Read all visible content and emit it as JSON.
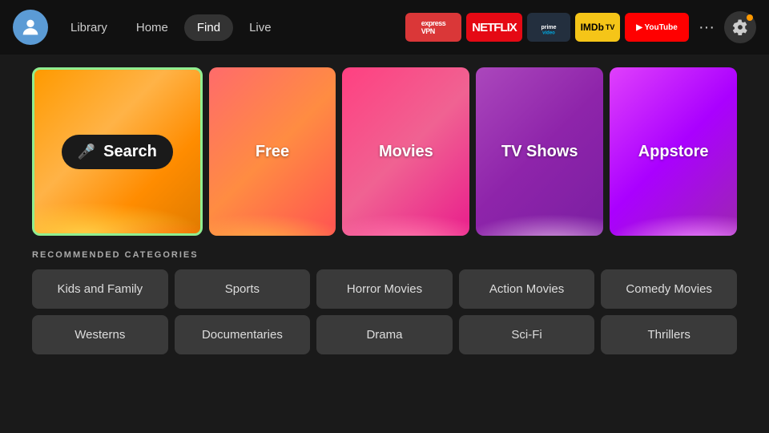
{
  "nav": {
    "links": [
      {
        "label": "Library",
        "active": false
      },
      {
        "label": "Home",
        "active": false
      },
      {
        "label": "Find",
        "active": true
      },
      {
        "label": "Live",
        "active": false
      }
    ],
    "apps": [
      {
        "id": "expressvpn",
        "label": "ExpressVPN"
      },
      {
        "id": "netflix",
        "label": "NETFLIX"
      },
      {
        "id": "prime",
        "label": "prime video"
      },
      {
        "id": "imdb",
        "label": "IMDb TV"
      },
      {
        "id": "youtube",
        "label": "▶ YouTube"
      },
      {
        "id": "more",
        "label": "···"
      }
    ],
    "settings_label": "⚙"
  },
  "tiles": [
    {
      "id": "search",
      "label": "Search",
      "type": "search"
    },
    {
      "id": "free",
      "label": "Free"
    },
    {
      "id": "movies",
      "label": "Movies"
    },
    {
      "id": "tvshows",
      "label": "TV Shows"
    },
    {
      "id": "appstore",
      "label": "Appstore"
    }
  ],
  "categories": {
    "section_title": "RECOMMENDED CATEGORIES",
    "rows": [
      [
        {
          "label": "Kids and Family"
        },
        {
          "label": "Sports"
        },
        {
          "label": "Horror Movies"
        },
        {
          "label": "Action Movies"
        },
        {
          "label": "Comedy Movies"
        }
      ],
      [
        {
          "label": "Westerns"
        },
        {
          "label": "Documentaries"
        },
        {
          "label": "Drama"
        },
        {
          "label": "Sci-Fi"
        },
        {
          "label": "Thrillers"
        }
      ]
    ]
  }
}
